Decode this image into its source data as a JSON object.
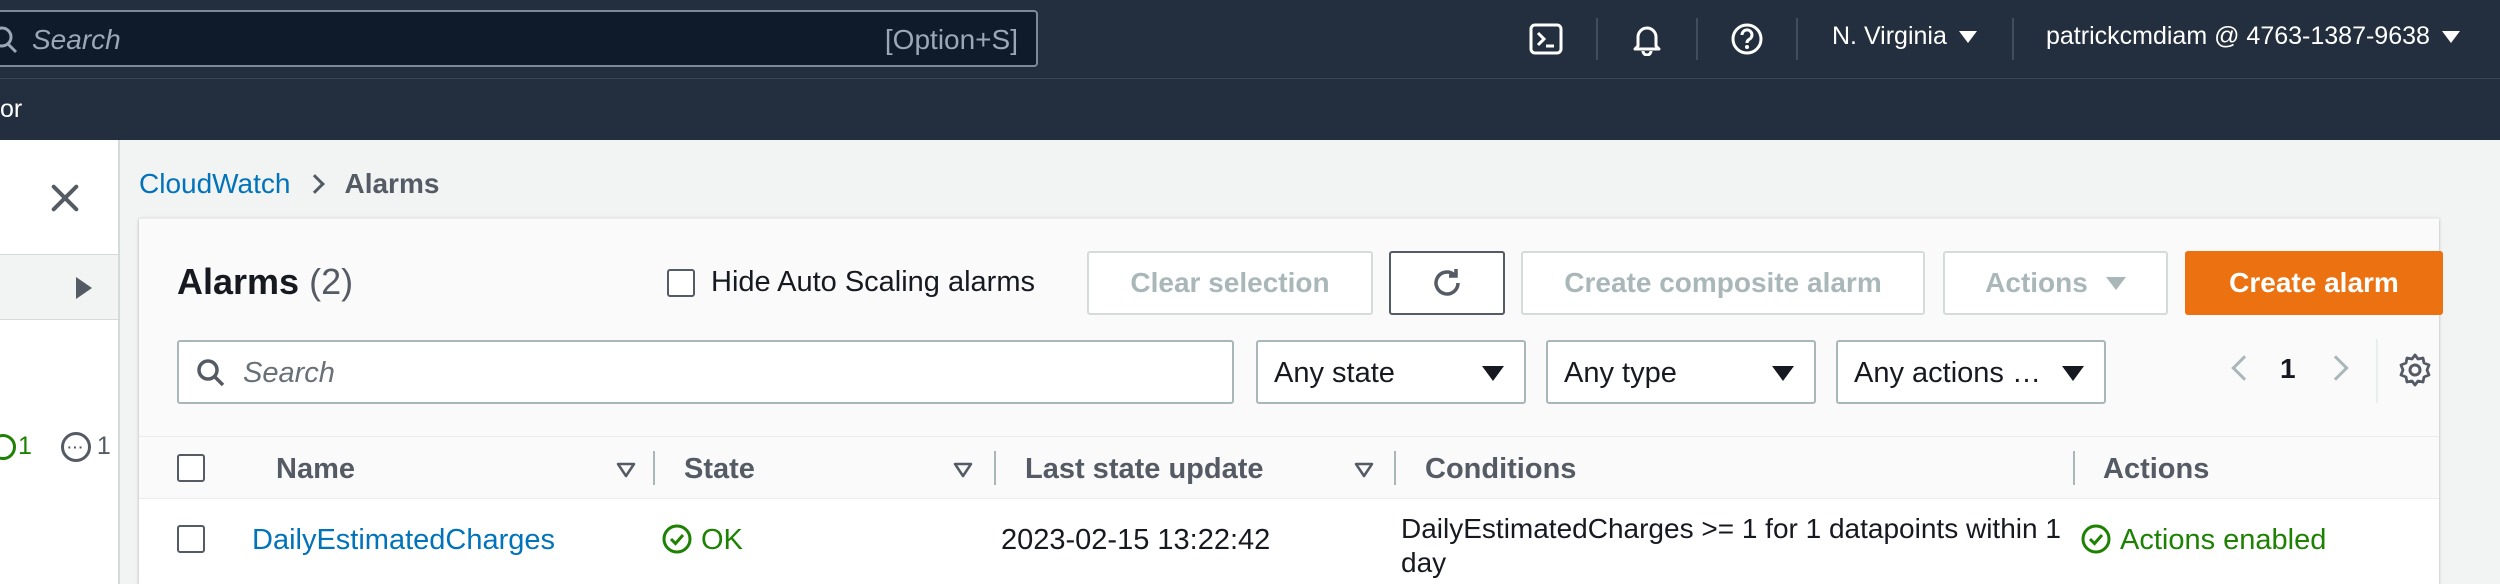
{
  "topnav": {
    "search_placeholder": "Search",
    "search_shortcut": "[Option+S]",
    "region": "N. Virginia",
    "account": "patrickcmdiam @ 4763-1387-9638",
    "subnav_fragment": "or"
  },
  "sidenav": {
    "ok_count": "1",
    "insufficient_count": "1"
  },
  "breadcrumb": {
    "root": "CloudWatch",
    "current": "Alarms"
  },
  "panel": {
    "title": "Alarms",
    "count": "(2)",
    "hide_autoscaling_label": "Hide Auto Scaling alarms",
    "buttons": {
      "clear_selection": "Clear selection",
      "create_composite": "Create composite alarm",
      "actions": "Actions",
      "create_alarm": "Create alarm"
    },
    "filter_placeholder": "Search",
    "filters": {
      "state": "Any state",
      "type": "Any type",
      "actions": "Any actions …"
    },
    "page_number": "1"
  },
  "table": {
    "columns": {
      "name": "Name",
      "state": "State",
      "last_update": "Last state update",
      "conditions": "Conditions",
      "actions": "Actions"
    },
    "rows": [
      {
        "name": "DailyEstimatedCharges",
        "state": "OK",
        "last_update": "2023-02-15 13:22:42",
        "conditions": "DailyEstimatedCharges >= 1 for 1 datapoints within 1 day",
        "actions": "Actions enabled"
      }
    ]
  },
  "colors": {
    "nav_bg": "#232f3e",
    "link": "#0073bb",
    "primary": "#ec7211",
    "ok": "#1d8102"
  },
  "icons": [
    "search-icon",
    "cloudshell-icon",
    "bell-icon",
    "help-icon",
    "close-icon",
    "expand-icon",
    "refresh-icon",
    "settings-icon",
    "check-circle-icon",
    "sort-icon"
  ]
}
